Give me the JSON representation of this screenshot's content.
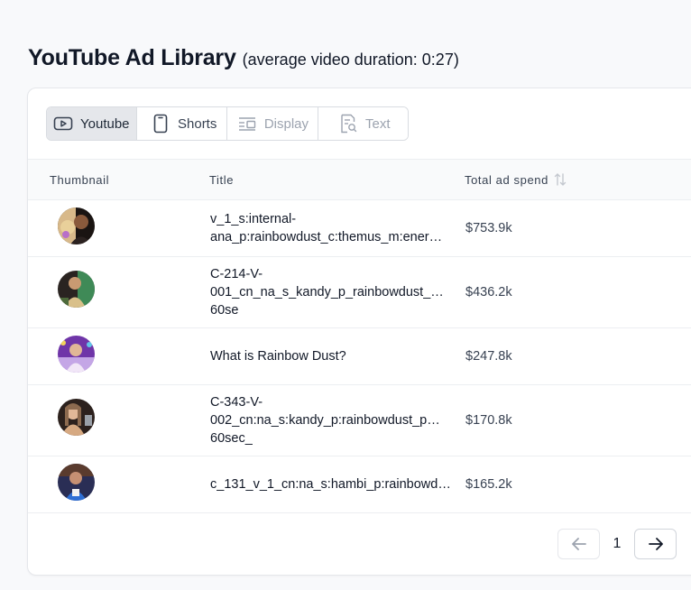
{
  "header": {
    "title": "YouTube Ad Library",
    "subtitle": "(average video duration: 0:27)"
  },
  "tabs": [
    {
      "label": "Youtube",
      "icon": "video-play-icon",
      "state": "active"
    },
    {
      "label": "Shorts",
      "icon": "phone-icon",
      "state": "normal"
    },
    {
      "label": "Display",
      "icon": "display-layout-icon",
      "state": "disabled"
    },
    {
      "label": "Text",
      "icon": "text-search-icon",
      "state": "disabled"
    }
  ],
  "table": {
    "columns": [
      "Thumbnail",
      "Title",
      "Total ad spend"
    ],
    "rows": [
      {
        "title_lines": [
          "v_1_s:internal-",
          "ana_p:rainbowdust_c:themus_m:ener…"
        ],
        "spend": "$753.9k",
        "thumb_colors": [
          "#c9a46a",
          "#2d1e1a"
        ]
      },
      {
        "title_lines": [
          "C-214-V-",
          "001_cn_na_s_kandy_p_rainbowdust_…",
          "60se"
        ],
        "spend": "$436.2k",
        "thumb_colors": [
          "#3b7d4f",
          "#1c1c1c"
        ]
      },
      {
        "title_lines": [
          "What is Rainbow Dust?"
        ],
        "spend": "$247.8k",
        "thumb_colors": [
          "#7b3fb5",
          "#e7d4f3"
        ]
      },
      {
        "title_lines": [
          "C-343-V-",
          "002_cn:na_s:kandy_p:rainbowdust_p…",
          "60sec_"
        ],
        "spend": "$170.8k",
        "thumb_colors": [
          "#d9b08c",
          "#3a2a25"
        ]
      },
      {
        "title_lines": [
          "c_131_v_1_cn:na_s:hambi_p:rainbowdu…"
        ],
        "spend": "$165.2k",
        "thumb_colors": [
          "#1f4fa8",
          "#6b3d2c"
        ]
      }
    ]
  },
  "pagination": {
    "page": "1",
    "prev_icon": "arrow-left-icon",
    "next_icon": "arrow-right-icon"
  }
}
